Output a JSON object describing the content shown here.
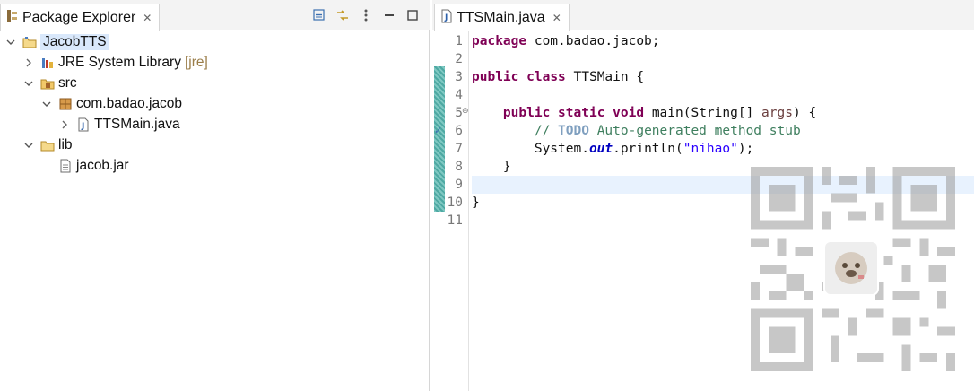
{
  "explorer": {
    "tab_label": "Package Explorer",
    "tree": [
      {
        "label": "JacobTTS",
        "expanded": true,
        "level": 0,
        "icon": "project-icon",
        "selected": true
      },
      {
        "label": "JRE System Library",
        "decoration": "[jre]",
        "expanded": false,
        "level": 1,
        "icon": "library-icon"
      },
      {
        "label": "src",
        "expanded": true,
        "level": 1,
        "icon": "source-folder-icon"
      },
      {
        "label": "com.badao.jacob",
        "expanded": true,
        "level": 2,
        "icon": "package-icon"
      },
      {
        "label": "TTSMain.java",
        "expanded": false,
        "level": 3,
        "icon": "java-file-icon"
      },
      {
        "label": "lib",
        "expanded": true,
        "level": 1,
        "icon": "folder-icon"
      },
      {
        "label": "jacob.jar",
        "level": 2,
        "icon": "jar-file-icon"
      }
    ]
  },
  "editor": {
    "tab_label": "TTSMain.java",
    "line_numbers": [
      "1",
      "2",
      "3",
      "4",
      "5",
      "6",
      "7",
      "8",
      "9",
      "10",
      "11"
    ],
    "current_line": 9,
    "code": {
      "l1_kw": "package",
      "l1_rest": " com.badao.jacob;",
      "l3_kw1": "public",
      "l3_kw2": "class",
      "l3_rest": " TTSMain {",
      "l5_indent": "    ",
      "l5_kw1": "public",
      "l5_kw2": "static",
      "l5_kw3": "void",
      "l5_mid": " main(String[] ",
      "l5_param": "args",
      "l5_end": ") {",
      "l6_indent": "        ",
      "l6_comment_start": "// ",
      "l6_todo": "TODO",
      "l6_comment_rest": " Auto-generated method stub",
      "l7_indent": "        ",
      "l7_start": "System.",
      "l7_field": "out",
      "l7_mid": ".println(",
      "l7_str": "\"nihao\"",
      "l7_end": ");",
      "l8": "    }",
      "l10": "}"
    }
  },
  "colors": {
    "keyword": "#7f0055",
    "comment": "#3f7f5f",
    "string": "#2a00ff",
    "current_line_bg": "#e8f2fe",
    "selection_bg": "#d9e8fb"
  }
}
